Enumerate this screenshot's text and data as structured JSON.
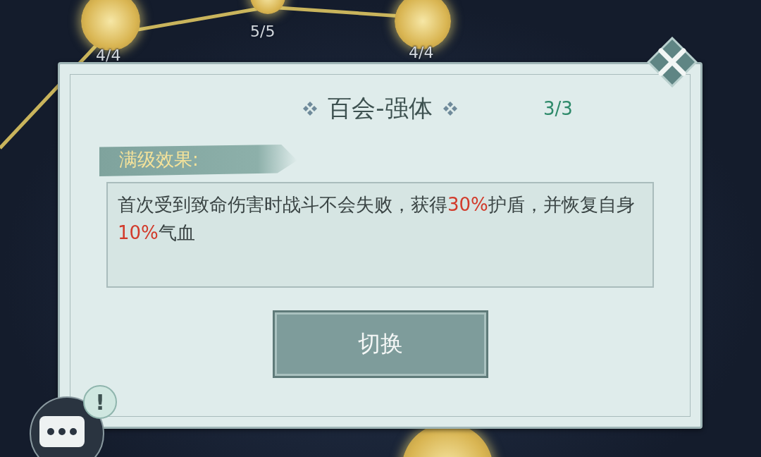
{
  "map_nodes": [
    {
      "label": "4/4"
    },
    {
      "label": "5/5"
    },
    {
      "label": "4/4"
    }
  ],
  "dialog": {
    "title": "百会-强体",
    "progress": "3/3",
    "section_label": "满级效果:",
    "effect": [
      {
        "text": "首次受到致命伤害时战斗不会失败，获得",
        "highlight": false
      },
      {
        "text": "30%",
        "highlight": true
      },
      {
        "text": "护盾，并恢复自身",
        "highlight": false
      },
      {
        "text": "10%",
        "highlight": true
      },
      {
        "text": "气血",
        "highlight": false
      }
    ],
    "button": "切换"
  },
  "chat_alert": "!"
}
